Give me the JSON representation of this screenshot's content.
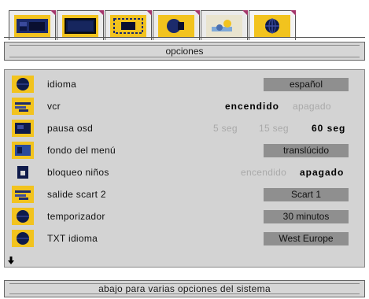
{
  "tabs": [
    {
      "icon": "picture-settings-icon"
    },
    {
      "icon": "screen-icon"
    },
    {
      "icon": "image-format-icon"
    },
    {
      "icon": "sound-icon"
    },
    {
      "icon": "tuning-icon"
    },
    {
      "icon": "options-globe-icon"
    }
  ],
  "title": "opciones",
  "menu": {
    "idioma": {
      "label": "idioma",
      "value": "español",
      "icon": "globe-icon"
    },
    "vcr": {
      "label": "vcr",
      "on": "encendido",
      "off": "apagado",
      "selected": "encendido",
      "icon": "vcr-icon"
    },
    "pausa_osd": {
      "label": "pausa osd",
      "options": [
        "5 seg",
        "15 seg",
        "60 seg"
      ],
      "selected": "60 seg",
      "icon": "osd-timer-icon"
    },
    "fondo_menu": {
      "label": "fondo del menú",
      "value": "translúcido",
      "icon": "menu-background-icon"
    },
    "bloqueo": {
      "label": "bloqueo niños",
      "on": "encendido",
      "off": "apagado",
      "selected": "apagado",
      "icon": "child-lock-icon"
    },
    "scart": {
      "label": "salide scart 2",
      "value": "Scart 1",
      "icon": "scart-icon"
    },
    "temporizador": {
      "label": "temporizador",
      "value": "30 minutos",
      "icon": "timer-globe-icon"
    },
    "txt_idioma": {
      "label": "TXT idioma",
      "value": "West Europe",
      "icon": "teletext-globe-icon"
    }
  },
  "help": "abajo para varias opciones del sistema",
  "colors": {
    "icon_bg": "#f2c31e",
    "tab_corner": "#a5366b",
    "panel_bg": "#d3d3d3",
    "value_box": "#8f8f8f"
  }
}
